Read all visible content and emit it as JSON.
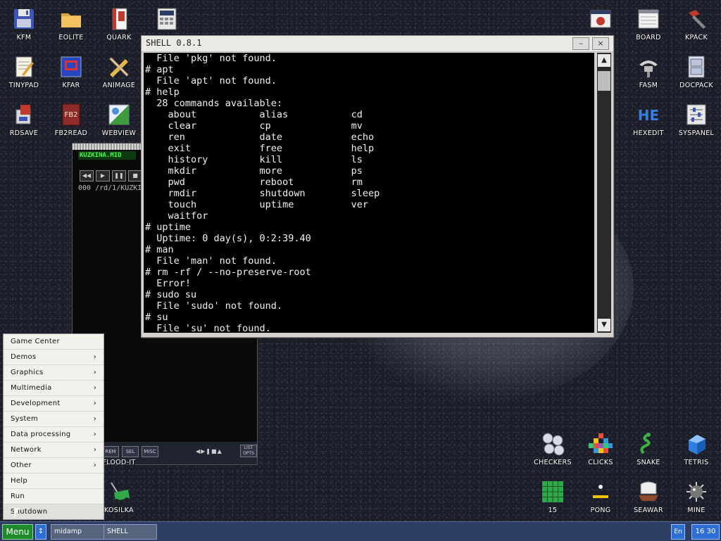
{
  "desktop": {
    "left_icons": [
      {
        "id": "kfm",
        "label": "KFM",
        "icon": "floppy-icon"
      },
      {
        "id": "eolite",
        "label": "EOLITE",
        "icon": "folder-icon"
      },
      {
        "id": "quark",
        "label": "QUARK",
        "icon": "book-icon"
      },
      {
        "id": "calc",
        "label": "",
        "icon": "calculator-icon"
      },
      {
        "id": "tinypad",
        "label": "TINYPAD",
        "icon": "notepad-icon"
      },
      {
        "id": "kfar",
        "label": "KFAR",
        "icon": "kfar-icon"
      },
      {
        "id": "animage",
        "label": "ANIMAGE",
        "icon": "pencil-ruler-icon"
      },
      {
        "id": "rdsave",
        "label": "RDSAVE",
        "icon": "rdsave-icon"
      },
      {
        "id": "fb2read",
        "label": "FB2READ",
        "icon": "fb2-book-icon"
      },
      {
        "id": "webview",
        "label": "WEBVIEW",
        "icon": "globe-icon"
      }
    ],
    "right_icons": [
      {
        "id": "debug",
        "label": "",
        "icon": "bug-icon"
      },
      {
        "id": "board",
        "label": "BOARD",
        "icon": "board-icon"
      },
      {
        "id": "kpack",
        "label": "KPACK",
        "icon": "hammer-icon"
      },
      {
        "id": "fasm",
        "label": "FASM",
        "icon": "fasm-icon"
      },
      {
        "id": "docpack",
        "label": "DOCPACK",
        "icon": "cabinet-icon"
      },
      {
        "id": "hexedit",
        "label": "HEXEDIT",
        "icon": "hex-icon"
      },
      {
        "id": "syspanel",
        "label": "SYSPANEL",
        "icon": "sliders-icon"
      }
    ],
    "game_icons": [
      {
        "id": "checkers",
        "label": "CHECKERS",
        "icon": "checkers-icon"
      },
      {
        "id": "clicks",
        "label": "CLICKS",
        "icon": "clicks-icon"
      },
      {
        "id": "snake",
        "label": "SNAKE",
        "icon": "snake-icon"
      },
      {
        "id": "tetris",
        "label": "TETRIS",
        "icon": "tetris-icon"
      },
      {
        "id": "fifteen",
        "label": "15",
        "icon": "grid-15-icon"
      },
      {
        "id": "pong",
        "label": "PONG",
        "icon": "pong-icon"
      },
      {
        "id": "seawar",
        "label": "SEAWAR",
        "icon": "ship-icon"
      },
      {
        "id": "mine",
        "label": "MINE",
        "icon": "mine-icon"
      }
    ],
    "misc_icons": [
      {
        "id": "floodit",
        "label": "FLOOD-IT"
      },
      {
        "id": "kosilka",
        "label": "KOSILKA",
        "icon": "lawnmower-icon"
      }
    ]
  },
  "midamp": {
    "song": "KUZKINA.MID",
    "path": "000 /rd/1/KUZKI",
    "buttons": [
      "REM",
      "SEL",
      "MISC",
      "LIST OPTS"
    ]
  },
  "shell": {
    "title": "SHELL 0.8.1",
    "minimize": "–",
    "close": "×",
    "lines": [
      "  File 'pkg' not found.",
      "# apt",
      "  File 'apt' not found.",
      "# help",
      "  28 commands available:",
      "    about           alias           cd",
      "    clear           cp              mv",
      "    ren             date            echo",
      "    exit            free            help",
      "    history         kill            ls",
      "    mkdir           more            ps",
      "    pwd             reboot          rm",
      "    rmdir           shutdown        sleep",
      "    touch           uptime          ver",
      "    waitfor",
      "# uptime",
      "  Uptime: 0 day(s), 0:2:39.40",
      "# man",
      "  File 'man' not found.",
      "# rm -rf / --no-preserve-root",
      "  Error!",
      "# sudo su",
      "  File 'sudo' not found.",
      "# su",
      "  File 'su' not found."
    ]
  },
  "menu": {
    "items": [
      {
        "label": "Game Center",
        "sub": false
      },
      {
        "label": "Demos",
        "sub": true
      },
      {
        "label": "Graphics",
        "sub": true
      },
      {
        "label": "Multimedia",
        "sub": true
      },
      {
        "label": "Development",
        "sub": true
      },
      {
        "label": "System",
        "sub": true
      },
      {
        "label": "Data processing",
        "sub": true
      },
      {
        "label": "Network",
        "sub": true
      },
      {
        "label": "Other",
        "sub": true
      },
      {
        "label": "Help",
        "sub": false
      },
      {
        "label": "Run",
        "sub": false
      },
      {
        "label": "Shutdown",
        "sub": false
      }
    ]
  },
  "taskbar": {
    "menu_label": "Menu",
    "arrow": "↕",
    "tasks": [
      "midamp",
      "SHELL"
    ],
    "lang": "En",
    "clock": "16 30"
  },
  "colors": {
    "taskbar": "#2c3e63",
    "menu_button": "#1f8a2a",
    "accent": "#2e6fd6"
  }
}
